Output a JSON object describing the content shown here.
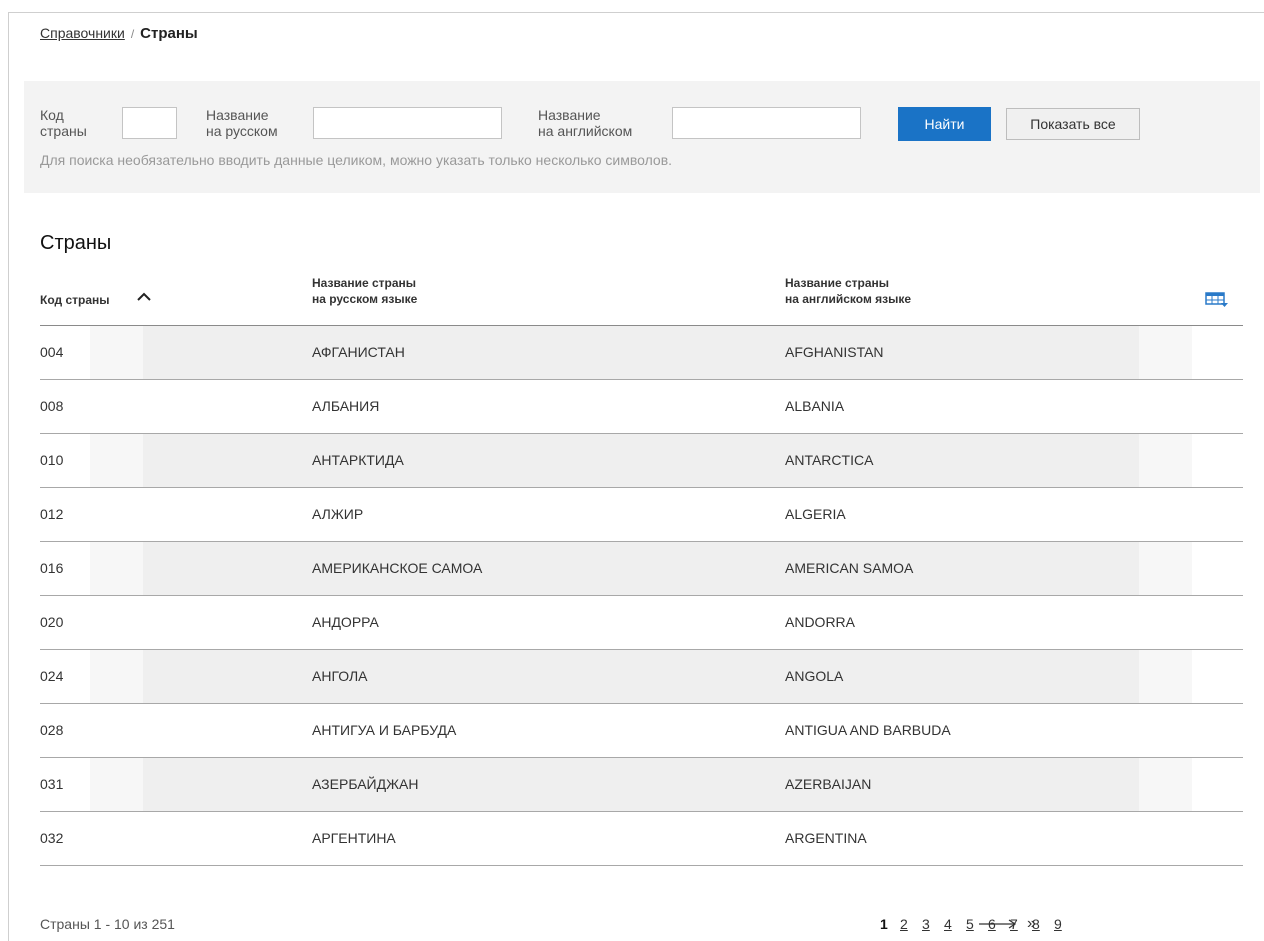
{
  "breadcrumb": {
    "parent": "Справочники",
    "separator": "/",
    "current": "Страны"
  },
  "search": {
    "code_label_1": "Код",
    "code_label_2": "страны",
    "ru_label_1": "Название",
    "ru_label_2": "на русском",
    "en_label_1": "Название",
    "en_label_2": "на английском",
    "code_value": "",
    "ru_value": "",
    "en_value": "",
    "find_button": "Найти",
    "show_all_button": "Показать все",
    "hint": "Для поиска необязательно вводить данные целиком, можно указать только несколько символов."
  },
  "section_title": "Страны",
  "table": {
    "headers": {
      "code": "Код страны",
      "ru_1": "Название страны",
      "ru_2": "на русском языке",
      "en_1": "Название страны",
      "en_2": "на английском языке"
    },
    "rows": [
      {
        "code": "004",
        "ru": "АФГАНИСТАН",
        "en": "AFGHANISTAN"
      },
      {
        "code": "008",
        "ru": "АЛБАНИЯ",
        "en": "ALBANIA"
      },
      {
        "code": "010",
        "ru": "АНТАРКТИДА",
        "en": "ANTARCTICA"
      },
      {
        "code": "012",
        "ru": "АЛЖИР",
        "en": "ALGERIA"
      },
      {
        "code": "016",
        "ru": "АМЕРИКАНСКОЕ САМОА",
        "en": "AMERICAN SAMOA"
      },
      {
        "code": "020",
        "ru": "АНДОРРА",
        "en": "ANDORRA"
      },
      {
        "code": "024",
        "ru": "АНГОЛА",
        "en": "ANGOLA"
      },
      {
        "code": "028",
        "ru": "АНТИГУА И БАРБУДА",
        "en": "ANTIGUA AND BARBUDA"
      },
      {
        "code": "031",
        "ru": "АЗЕРБАЙДЖАН",
        "en": "AZERBAIJAN"
      },
      {
        "code": "032",
        "ru": "АРГЕНТИНА",
        "en": "ARGENTINA"
      }
    ]
  },
  "footer": {
    "summary": "Страны 1 - 10 из 251",
    "pages": [
      "1",
      "2",
      "3",
      "4",
      "5",
      "6",
      "7",
      "8",
      "9"
    ],
    "current_page": "1",
    "last_symbol": "»"
  },
  "icons": {
    "sort": "chevron-up-icon",
    "columns": "table-settings-icon",
    "next": "arrow-right-icon",
    "last": "double-chevron-right-icon"
  },
  "colors": {
    "accent": "#1a73c6",
    "panel": "#f3f3f3",
    "row_shade": "#efefef"
  }
}
